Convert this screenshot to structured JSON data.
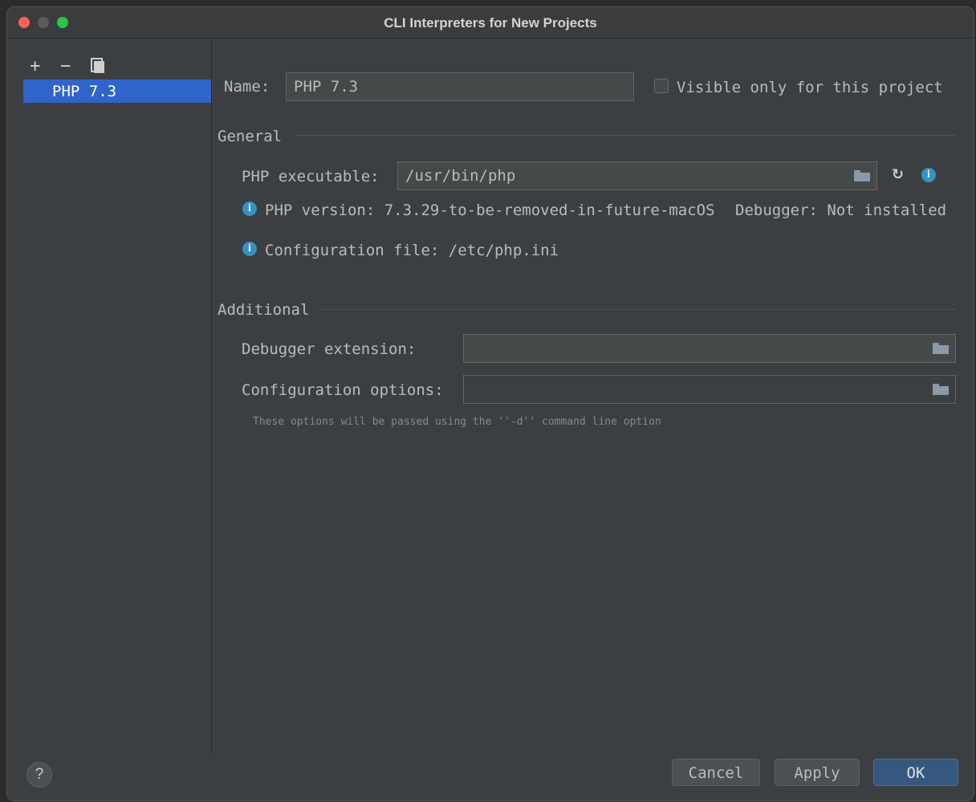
{
  "window": {
    "title": "CLI Interpreters for New Projects"
  },
  "sidebar": {
    "toolbar": {
      "add": "+",
      "remove": "−"
    },
    "items": [
      {
        "label": "PHP 7.3"
      }
    ]
  },
  "form": {
    "name_label": "Name:",
    "name_value": "PHP 7.3",
    "visible_only_label": "Visible only for this project",
    "general": {
      "title": "General",
      "php_executable_label": "PHP executable:",
      "php_executable_value": "/usr/bin/php",
      "php_version_text": "PHP version: 7.3.29-to-be-removed-in-future-macOS",
      "debugger_text": "Debugger: Not installed",
      "config_file_text": "Configuration file: /etc/php.ini"
    },
    "additional": {
      "title": "Additional",
      "debugger_extension_label": "Debugger extension:",
      "debugger_extension_value": "",
      "config_options_label": "Configuration options:",
      "config_options_value": "",
      "config_options_hint": "These options will be passed using the ''-d'' command line option"
    }
  },
  "footer": {
    "help": "?",
    "cancel": "Cancel",
    "apply": "Apply",
    "ok": "OK"
  },
  "colors": {
    "accent": "#2f65ca",
    "info": "#3592c4",
    "background": "#3c3f41"
  }
}
